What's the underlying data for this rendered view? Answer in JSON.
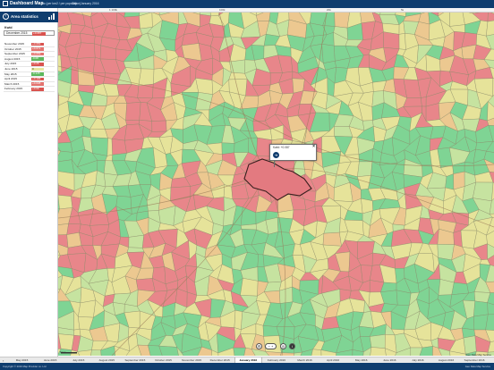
{
  "app": {
    "title": "Dashboard Map",
    "crumbs": [
      "Inc (per km2 / per population)",
      "City",
      "January 2016"
    ]
  },
  "ruler": [
    "1 100k",
    "100k",
    "20k",
    "5k"
  ],
  "panel": {
    "title": "Area statistics",
    "kpi_label": "Kwid",
    "kpi": {
      "month": "December 2015",
      "value": "+0.087",
      "color": "#d9534f"
    },
    "months": [
      {
        "month": "November 2015",
        "value": "+0.083",
        "color": "#d9534f"
      },
      {
        "month": "October 2015",
        "value": "+0.071",
        "color": "#e4736f"
      },
      {
        "month": "September 2015",
        "value": "+0.069",
        "color": "#e4736f"
      },
      {
        "month": "August 2015",
        "value": "-0.08",
        "color": "#5cb85c"
      },
      {
        "month": "July 2015",
        "value": "+0.26",
        "color": "#d9534f"
      },
      {
        "month": "June 2015",
        "value": "0",
        "color": "#e8e6a0"
      },
      {
        "month": "May 2015",
        "value": "-0.145",
        "color": "#5cb85c"
      },
      {
        "month": "April 2015",
        "value": "+0.196",
        "color": "#d9534f"
      },
      {
        "month": "March 2015",
        "value": "+0.038",
        "color": "#e4736f"
      },
      {
        "month": "February 2015",
        "value": "+0.09",
        "color": "#d9534f"
      }
    ]
  },
  "popup": {
    "title": "Kwid: +0.087",
    "close": "×",
    "icon": "link-icon"
  },
  "controls": [
    "settings-icon",
    "zoom-pill",
    "locate-icon",
    "info-icon"
  ],
  "scale": "5 km",
  "attribution": "Geo Data Map Service",
  "timeline": {
    "months": [
      "May 2015",
      "June 2015",
      "July 2015",
      "August 2015",
      "September 2015",
      "October 2015",
      "November 2015",
      "December 2015",
      "January 2016",
      "February 2016",
      "March 2016",
      "April 2016",
      "May 2016",
      "June 2016",
      "July 2016",
      "August 2016",
      "September 2016"
    ],
    "active": "January 2016"
  },
  "footer": {
    "left": "Copyright © 2016 Map Provider co. Ltd",
    "right": "Geo Data Map Service"
  },
  "legend_colors": {
    "red": "#e8868a",
    "green": "#7fd494",
    "yellow": "#e6e39a",
    "lightgreen": "#c6e3a0",
    "orange": "#ecc890"
  }
}
